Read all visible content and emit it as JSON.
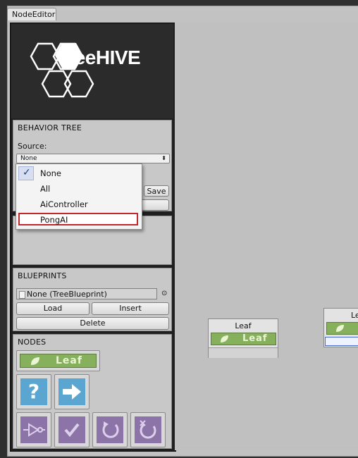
{
  "window": {
    "tab_title": "NodeEditor"
  },
  "logo": {
    "text": "BeeHIVE"
  },
  "behavior_tree": {
    "title": "BEHAVIOR TREE",
    "source_label": "Source:",
    "source_value": "None",
    "save_label": "Save",
    "dropdown": {
      "options": [
        "None",
        "All",
        "AiController",
        "PongAI"
      ],
      "checked": "None",
      "highlighted": "PongAI"
    }
  },
  "blueprints": {
    "title": "BLUEPRINTS",
    "field_value": "None (TreeBlueprint)",
    "load_label": "Load",
    "insert_label": "Insert",
    "delete_label": "Delete"
  },
  "nodes": {
    "title": "NODES",
    "leaf_label": "Leaf",
    "icons": [
      "question-icon",
      "arrow-right-icon",
      "inverter-icon",
      "checkmark-icon",
      "repeat-icon",
      "repeat-cancel-icon"
    ]
  },
  "canvas": {
    "node1_title": "Leaf",
    "node1_leaf": "Leaf",
    "node2_title": "Le"
  },
  "colors": {
    "leaf_green": "#87b05c",
    "blue_icon": "#5aa6d1",
    "purple_icon": "#8c73a8",
    "highlight_red": "#c0282e"
  }
}
